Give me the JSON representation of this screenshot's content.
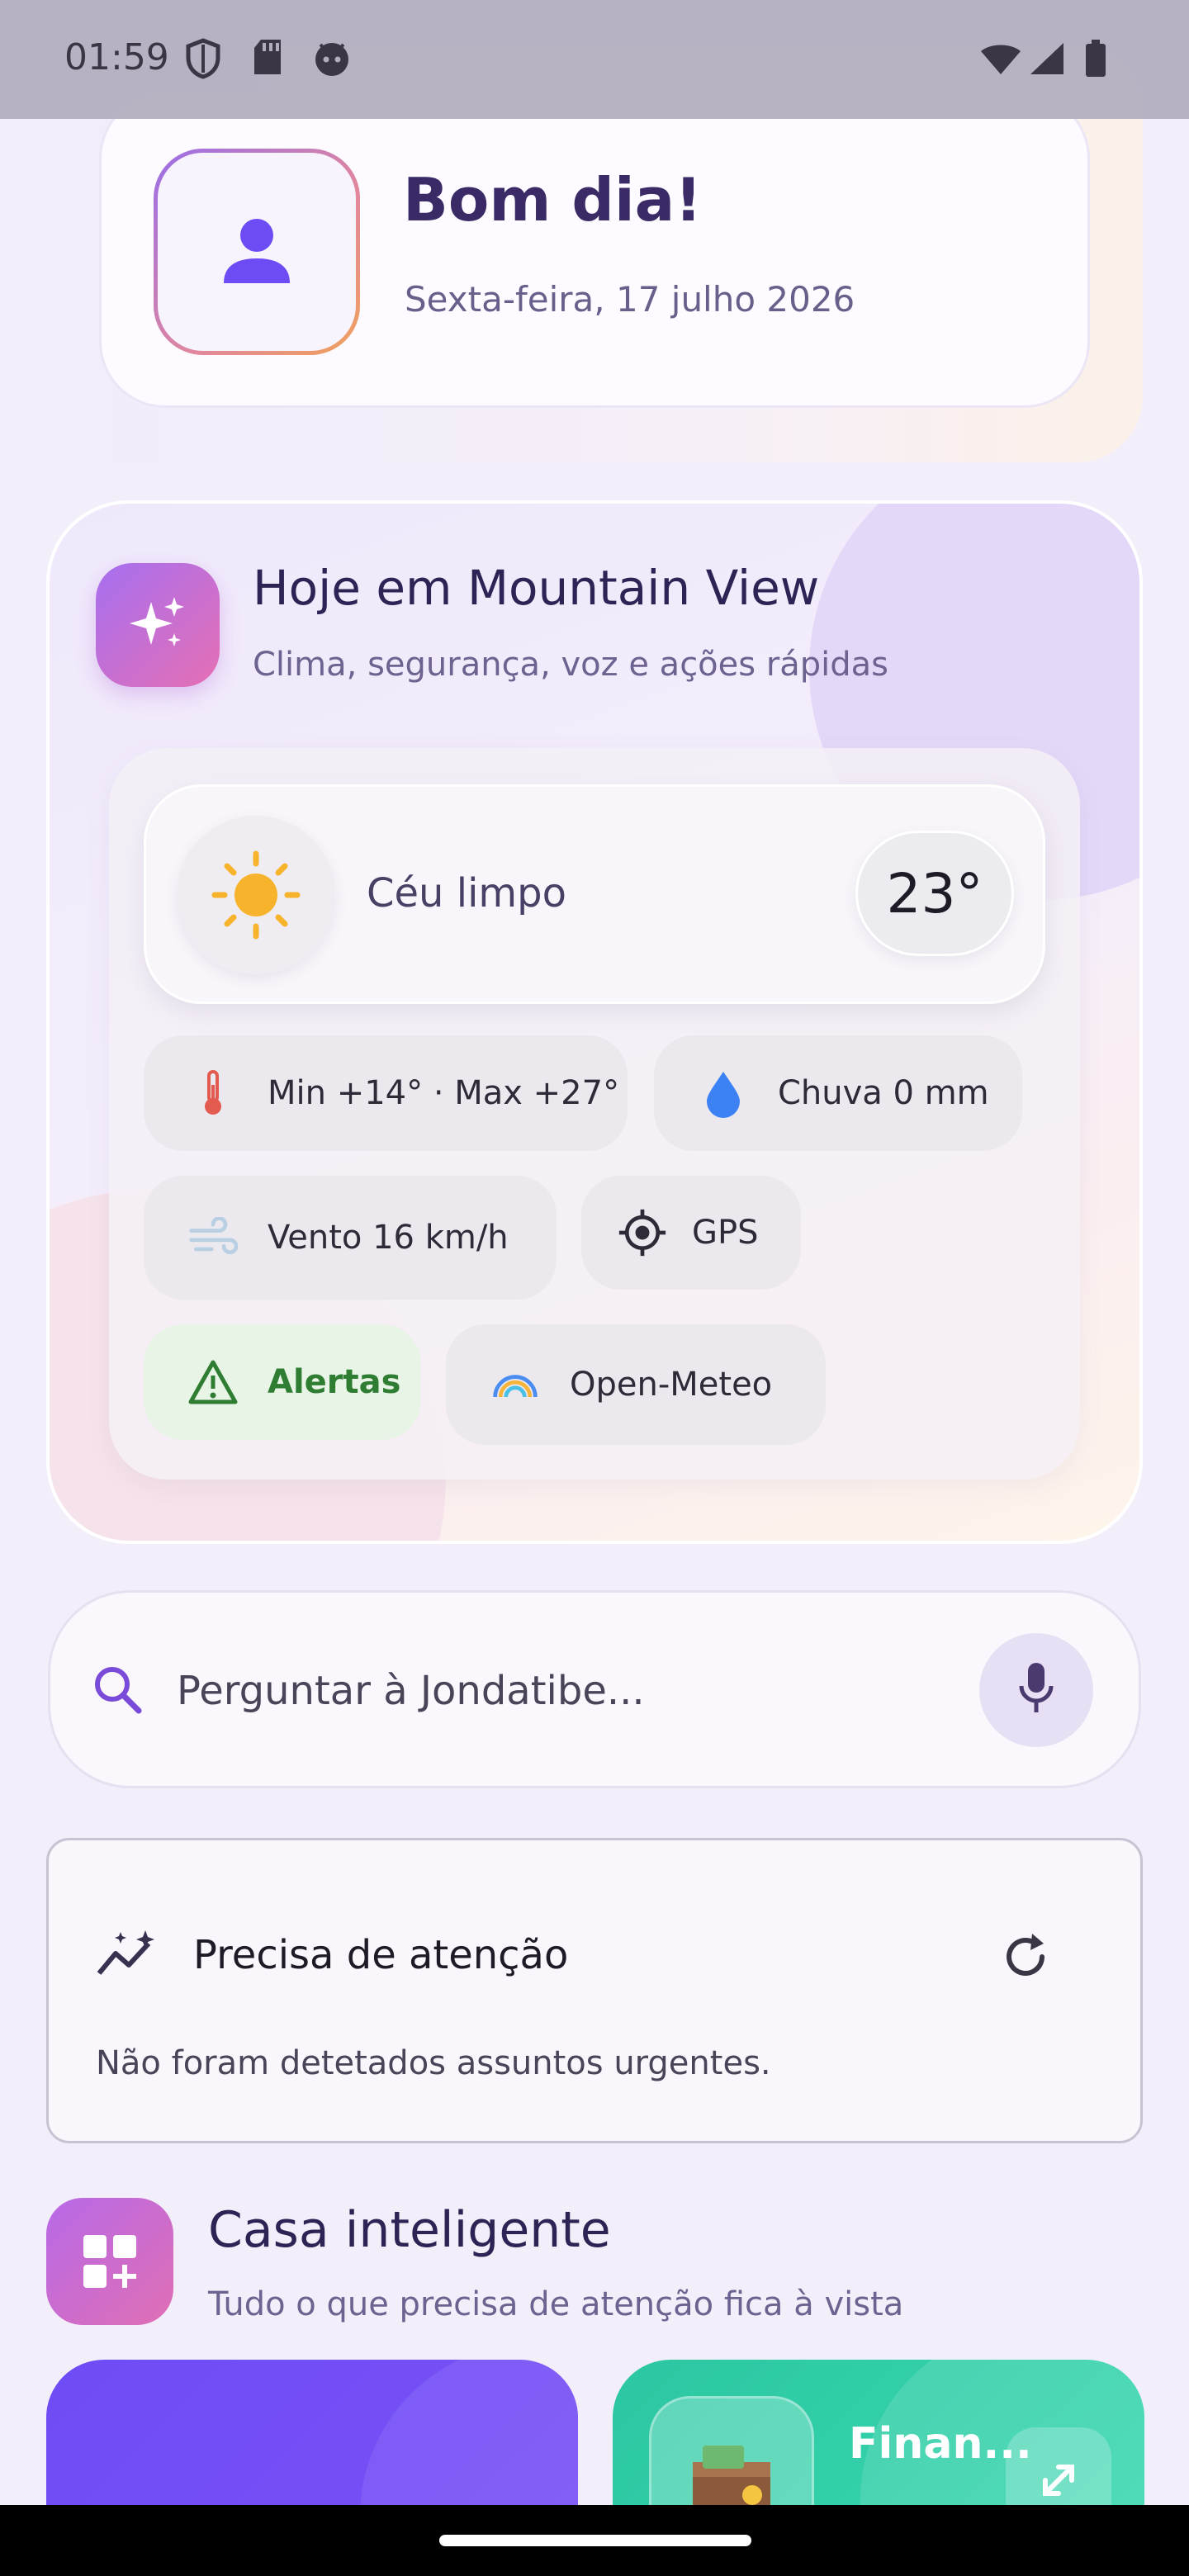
{
  "status_bar": {
    "time": "01:59"
  },
  "greeting": {
    "title": "Bom dia!",
    "date": "Sexta-feira, 17 julho 2026"
  },
  "today": {
    "title": "Hoje em Mountain View",
    "subtitle": "Clima, segurança, voz e ações rápidas",
    "condition": "Céu limpo",
    "temperature": "23°",
    "chips": {
      "minmax": "Min +14° · Max +27°",
      "rain": "Chuva 0 mm",
      "wind": "Vento 16 km/h",
      "gps": "GPS",
      "alerts": "Alertas",
      "source": "Open-Meteo"
    }
  },
  "search": {
    "placeholder": "Perguntar à Jondatibe..."
  },
  "attention": {
    "title": "Precisa de atenção",
    "message": "Não foram detetados assuntos urgentes."
  },
  "smart_home": {
    "title": "Casa inteligente",
    "subtitle": "Tudo o que precisa de atenção fica à vista",
    "tiles": [
      {
        "label": ""
      },
      {
        "label": "Finan..."
      }
    ]
  },
  "colors": {
    "accent": "#6e4cf5",
    "teal": "#2cc7a2",
    "alert_green": "#2e7d32"
  }
}
